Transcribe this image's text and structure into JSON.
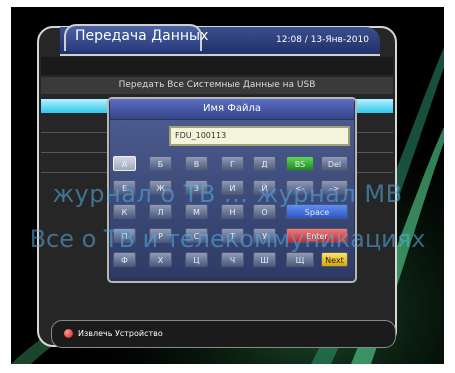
{
  "header": {
    "title": "Передача Данных",
    "datetime": "12:08 / 13-Янв-2010"
  },
  "subtitle": "Передать Все Системные Данные на USB",
  "dialog": {
    "title": "Имя Файла",
    "filename_value": "FDU_100113"
  },
  "keyboard": {
    "rows": [
      [
        "А",
        "Б",
        "В",
        "Г",
        "Д"
      ],
      [
        "Е",
        "Ж",
        "З",
        "И",
        "Й"
      ],
      [
        "К",
        "Л",
        "М",
        "Н",
        "О"
      ],
      [
        "П",
        "Р",
        "С",
        "Т",
        "У"
      ],
      [
        "Ф",
        "Х",
        "Ц",
        "Ч",
        "Ш",
        "Щ"
      ]
    ],
    "bs_label": "BS",
    "del_label": "Del",
    "left_label": "<-",
    "right_label": "->",
    "space_label": "Space",
    "enter_label": "Enter",
    "next_label": "Next"
  },
  "footer": {
    "eject_label": "Извлечь Устройство"
  },
  "watermark": {
    "line1": "журнал о ТВ ... журнал МВ",
    "line2": "Все о ТВ и телекоммуникациях"
  },
  "colors": {
    "accent_green": "#2fa82f",
    "accent_blue": "#3e6fd8",
    "accent_red": "#d83a3a",
    "accent_yellow": "#f2c21a",
    "selection_cyan": "#2ec9ec"
  }
}
